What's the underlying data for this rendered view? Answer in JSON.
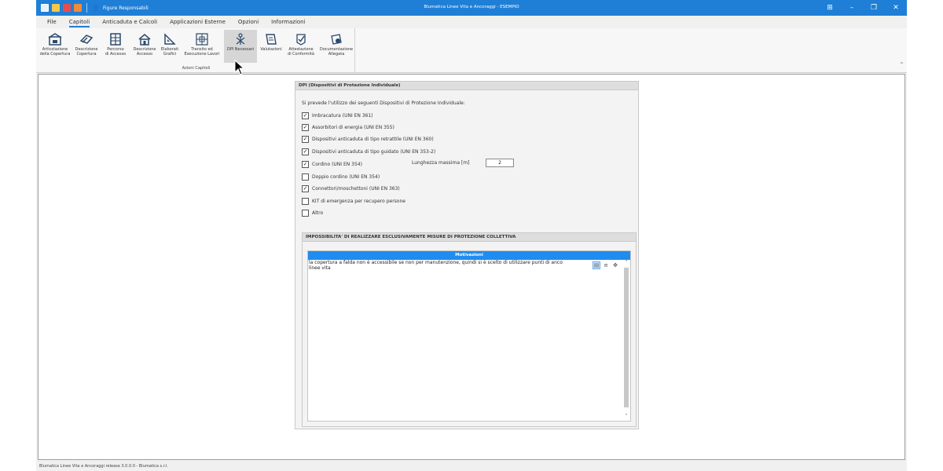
{
  "window": {
    "title": "Blumatica Linee Vita e Ancoraggi - ESEMPIO",
    "figure_label": "Figure Responsabili",
    "controls": [
      "⊞",
      "–",
      "❐",
      "✕"
    ]
  },
  "menu": {
    "items": [
      "File",
      "Capitoli",
      "Anticaduta e Calcoli",
      "Applicazioni Esterne",
      "Opzioni",
      "Informazioni"
    ],
    "active": "Capitoli"
  },
  "ribbon": {
    "buttons": [
      {
        "label1": "Articolazione",
        "label2": "della Copertura"
      },
      {
        "label1": "Descrizione",
        "label2": "Copertura"
      },
      {
        "label1": "Percorso",
        "label2": "di Accesso"
      },
      {
        "label1": "Descrizione",
        "label2": "Accesso"
      },
      {
        "label1": "Elaborati",
        "label2": "Grafici"
      },
      {
        "label1": "Transito ed",
        "label2": "Esecuzione Lavori"
      },
      {
        "label1": "DPI Necessari",
        "label2": ""
      },
      {
        "label1": "Valutazioni",
        "label2": ""
      },
      {
        "label1": "Attestazione",
        "label2": "di Conformità"
      },
      {
        "label1": "Documentazione",
        "label2": "Allegata"
      }
    ],
    "group_caption": "Azioni Capitoli"
  },
  "dpi": {
    "header": "DPI (Dispositivi di Protezione Individuale)",
    "intro": "Si prevede l'utilizzo dei seguenti Dispositivi di Protezione Individuale:",
    "items": [
      {
        "label": "Imbracatura (UNI EN 361)",
        "checked": true
      },
      {
        "label": "Assorbitori di energia (UNI EN 355)",
        "checked": true
      },
      {
        "label": "Dispositivi anticaduta di tipo retrattile (UNI EN 360)",
        "checked": true
      },
      {
        "label": "Dispositivi anticaduta di tipo guidato (UNI EN 353-2)",
        "checked": true
      },
      {
        "label": "Cordino (UNI EN 354)",
        "checked": true
      },
      {
        "label": "Doppio cordino (UNI EN 354)",
        "checked": false
      },
      {
        "label": "Connettori/moschettoni (UNI EN 363)",
        "checked": true
      },
      {
        "label": "KIT di emergenza per recupero persone",
        "checked": false
      },
      {
        "label": "Altro",
        "checked": false
      }
    ],
    "length_label": "Lunghezza massima [m]",
    "length_value": "2"
  },
  "impossibility": {
    "header": "IMPOSSIBILITA' DI REALIZZARE ESCLUSIVAMENTE MISURE  DI PROTEZIONE COLLETTIVA",
    "grid_header": "Motivazioni",
    "text": "la copertura a falda non è accessibile se non per manutenzione, quindi si è scelto di utilizzare punti di anco",
    "text_line2": "linee vita"
  },
  "status": "Blumatica Linee Vita e Ancoraggi release 3.0.0.0 - Blumatica s.r.l.",
  "colors": {
    "accent": "#1f7fd6",
    "grid_header": "#1f8cf0"
  }
}
